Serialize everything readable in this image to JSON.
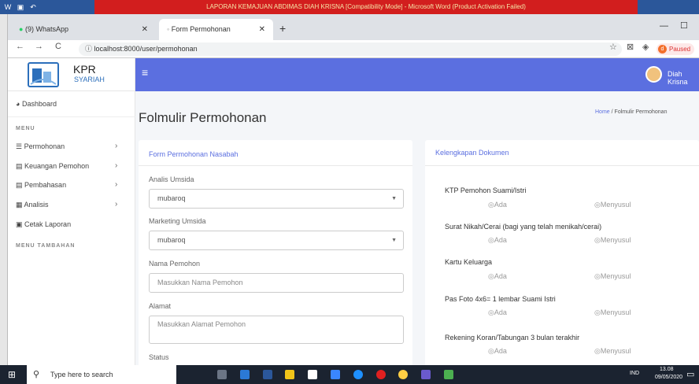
{
  "word": {
    "title": "LAPORAN KEMAJUAN ABDIMAS DIAH KRISNA [Compatibility Mode] - Microsoft Word (Product Activation Failed)"
  },
  "browser": {
    "tabs": [
      {
        "label": "(9) WhatsApp"
      },
      {
        "label": "Form Permohonan"
      }
    ],
    "url": "localhost:8000/user/permohonan",
    "profile_initial": "d",
    "profile_status": "Paused"
  },
  "app": {
    "logo_kpr": "KPR",
    "logo_syariah": "SYARIAH",
    "user_name": "Diah Krisna",
    "sidebar": {
      "dashboard": "Dashboard",
      "menu_header": "MENU",
      "items": [
        {
          "label": "Permohonan"
        },
        {
          "label": "Keuangan Pemohon"
        },
        {
          "label": "Pembahasan"
        },
        {
          "label": "Analisis"
        },
        {
          "label": "Cetak Laporan"
        }
      ],
      "menu2_header": "MENU TAMBAHAN"
    },
    "page_title": "Folmulir Permohonan",
    "breadcrumb": {
      "home": "Home",
      "sep": "/",
      "current": "Folmulir Permohonan"
    },
    "form": {
      "title": "Form Permohonan Nasabah",
      "analis_label": "Analis Umsida",
      "analis_value": "mubaroq",
      "marketing_label": "Marketing Umsida",
      "marketing_value": "mubaroq",
      "nama_label": "Nama Pemohon",
      "nama_placeholder": "Masukkan Nama Pemohon",
      "alamat_label": "Alamat",
      "alamat_placeholder": "Masukkan Alamat Pemohon",
      "status_label": "Status"
    },
    "docs": {
      "title": "Kelengkapan Dokumen",
      "option_ada": "Ada",
      "option_menyusul": "Menyusul",
      "items": [
        {
          "label": "KTP Pemohon Suami/Istri"
        },
        {
          "label": "Surat Nikah/Cerai (bagi yang telah menikah/cerai)"
        },
        {
          "label": "Kartu Keluarga"
        },
        {
          "label": "Pas Foto 4x6= 1 lembar Suami Istri"
        },
        {
          "label": "Rekening Koran/Tabungan 3 bulan terakhir"
        }
      ]
    }
  },
  "taskbar": {
    "search_placeholder": "Type here to search",
    "lang": "IND",
    "time": "13.08",
    "date": "09/05/2020"
  }
}
